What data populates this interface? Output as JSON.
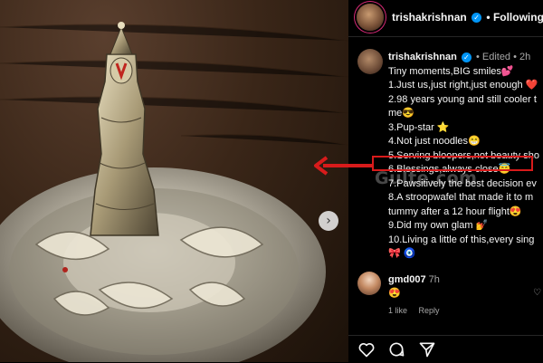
{
  "post": {
    "header_username": "trishakrishnan",
    "follow_status": "Following",
    "caption_username": "trishakrishnan",
    "edited_label": "Edited",
    "time_ago": "2h",
    "caption_lines": [
      "Tiny moments,BIG smiles💕",
      "1.Just us,just right,just enough ❤️",
      "2.98 years young and still cooler t",
      "me😎",
      "3.Pup-star ⭐",
      "4.Not just noodles😁",
      "5.Serving bloopers,not beauty sho",
      "6.Blessings,always close😇",
      "7.Pawsitively the best decision ev",
      "8.A stroopwafel that made it to m",
      "tummy after a 12 hour flight😍",
      "9.Did my own glam 💅",
      "10.Living a little of this,every sing",
      "🎀 🧿"
    ]
  },
  "comment": {
    "username": "gmd007",
    "time_ago": "7h",
    "text": "😍",
    "likes_label": "1 like",
    "reply_label": "Reply"
  },
  "watermark": "Gulte.com",
  "icons": {
    "next": "chevron-right-icon",
    "like": "heart-icon",
    "comment": "comment-icon",
    "share": "send-icon",
    "verified": "verified-badge-icon"
  },
  "colors": {
    "highlight": "#d81b1b",
    "verified": "#0095f6",
    "panel_bg": "#000000",
    "muted_text": "#a8a8a8"
  }
}
